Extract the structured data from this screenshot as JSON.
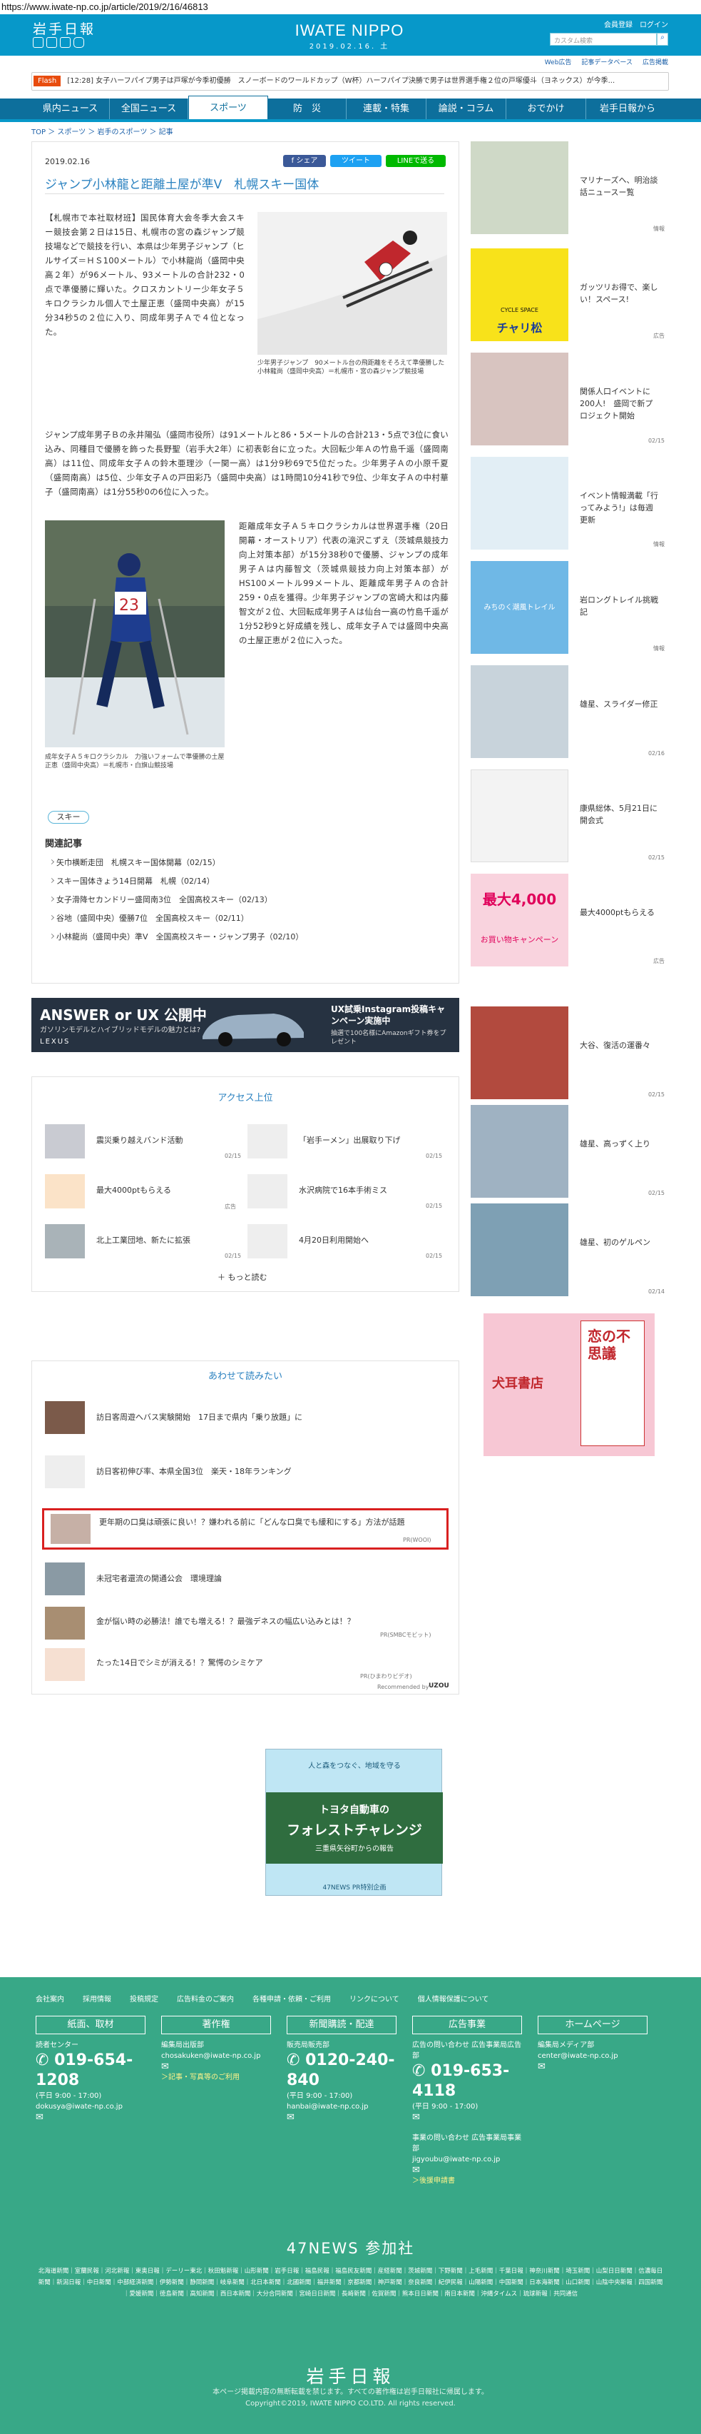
{
  "url": "https://www.iwate-np.co.jp/article/2019/2/16/46813",
  "header": {
    "logo_jp": "岩手日報",
    "logo_en": "IWATE NIPPO",
    "date": "2019.02.16. 土",
    "login": "会員登録　ログイン",
    "search_placeholder": "カスタム検索",
    "sublinks": [
      "Web広告",
      "記事データベース",
      "広告掲載"
    ]
  },
  "flash": {
    "label": "Flash",
    "text": "[12:28] 女子ハーフパイプ男子は戸塚が今季初優勝　スノーボードのワールドカップ（W杯）ハーフパイプ決勝で男子は世界選手権２位の戸塚優斗（ヨネックス）が今季..."
  },
  "nav": [
    "県内ニュース",
    "全国ニュース",
    "スポーツ",
    "防　災",
    "連載・特集",
    "論説・コラム",
    "おでかけ",
    "岩手日報から"
  ],
  "breadcrumb": "TOP ＞ スポーツ ＞ 岩手のスポーツ ＞ 記事",
  "article": {
    "date": "2019.02.16",
    "share": [
      "f シェア",
      "ツイート",
      "LINEで送る"
    ],
    "title": "ジャンプ小林龍と距離土屋が準V　札幌スキー国体",
    "p1": "【札幌市で本社取材班】国民体育大会冬季大会スキー競技会第２日は15日、札幌市の宮の森ジャンプ競技場などで競技を行い、本県は少年男子ジャンプ（ヒルサイズ＝ＨＳ100メートル）で小林龍尚（盛岡中央高２年）が96メートル、93メートルの合計232・0点で準優勝に輝いた。クロスカントリー少年女子５キロクラシカル個人で土屋正恵（盛岡中央高）が15分34秒5の２位に入り、同成年男子Ａで４位となった。",
    "p2": "ジャンプ成年男子Ｂの永井陽弘（盛岡市役所）は91メートルと86・5メートルの合計213・5点で3位に食い込み、同種目で優勝を飾った長野聖（岩手大2年）に初表彰台に立った。大回転少年Ａの竹島千遥（盛岡南高）は11位、同成年女子Ａの鈴木亜理沙（一関一高）は1分9秒69で5位だった。少年男子Ａの小原千夏（盛岡南高）は5位、少年女子Ａの戸田彩乃（盛岡中央高）は1時間10分41秒で9位、少年女子Ａの中村華子（盛岡南高）は1分55秒0の6位に入った。",
    "p3": "距離成年女子Ａ５キロクラシカルは世界選手権（20日開幕・オーストリア）代表の滝沢こずえ（茨城県競技力向上対策本部）が15分38秒0で優勝、ジャンプの成年男子Ａは内藤智文（茨城県競技力向上対策本部）がHS100メートル99メートル、距離成年男子Ａの合計259・0点を獲得。少年男子ジャンプの宮崎大和は内藤智文が２位、大回転成年男子Ａは仙台一高の竹島千遥が1分52秒9と好成績を残し、成年女子Ａでは盛岡中央高の土屋正恵が２位に入った。",
    "photo1_caption": "少年男子ジャンプ　90メートル台の飛距離をそろえて準優勝した小林龍尚（盛岡中央高）＝札幌市・宮の森ジャンプ競技場",
    "photo2_caption": "成年女子Ａ５キロクラシカル　力強いフォームで準優勝の土屋正恵（盛岡中央高）＝札幌市・白旗山競技場",
    "tag": "スキー",
    "related_title": "関連記事",
    "related": [
      "矢巾横断走団　札幌スキー国体開幕（02/15）",
      "スキー国体きょう14日開幕　札幌（02/14）",
      "女子滑降セカンドリー盛岡南3位　全国高校スキー（02/13）",
      "谷地（盛岡中央）優勝7位　全国高校スキー（02/11）",
      "小林龍尚（盛岡中央）準V　全国高校スキー・ジャンプ男子（02/10）"
    ]
  },
  "banner_ad": {
    "left_title": "ANSWER or UX 公開中",
    "left_sub": "ガソリンモデルとハイブリッドモデルの魅力とは?",
    "brand": "LEXUS",
    "right_title": "UX試乗Instagram投稿キャンペーン実施中",
    "right_sub": "抽選で100名様にAmazonギフト券をプレゼント"
  },
  "ranking": {
    "title": "アクセス上位",
    "items": [
      {
        "text": "震災乗り越えバンド活動",
        "date": "02/15"
      },
      {
        "text": "「岩手ーメン」出展取り下げ",
        "date": "02/15"
      },
      {
        "text": "最大4000ptもらえる",
        "date": "広告"
      },
      {
        "text": "水沢病院で16本手術ミス",
        "date": "02/15"
      },
      {
        "text": "北上工業団地、新たに拡張",
        "date": "02/15"
      },
      {
        "text": "4月20日利用開始へ",
        "date": "02/15"
      }
    ],
    "more": "もっと読む"
  },
  "together": {
    "title": "あわせて読みたい",
    "items": [
      {
        "text": "訪日客周遊へバス実験開始　17日まで県内「乗り放題」に",
        "meta": ""
      },
      {
        "text": "訪日客初伸び率、本県全国3位　楽天・18年ランキング",
        "meta": ""
      },
      {
        "text": "更年期の口臭は頑張に良い！？嫌われる前に「どんな口臭でも緩和にする」方法が話題",
        "meta": "PR(WOOI)"
      },
      {
        "text": "未冠宅者還流の開通公会　環境理論",
        "meta": ""
      },
      {
        "text": "金が悩い時の必勝法！誰でも増える！？最強デネスの幅広い込みとは！？",
        "meta": "PR(SMBCモビット)"
      },
      {
        "text": "たった14日でシミが消える！？驚愕のシミケア",
        "meta": "PR(ひまわりビデオ)"
      }
    ],
    "recommended": "Recommended by"
  },
  "bottom_ad": {
    "line1": "人と森をつなぐ、地域を守る",
    "line2": "トヨタ自動車の",
    "line3": "フォレストチャレンジ",
    "line4": "三重県矢谷町からの報告",
    "footer": "47NEWS PR特別企画"
  },
  "sidebar": [
    {
      "text": "マリナーズへ、明治談話ニュースー覧",
      "meta": "情報"
    },
    {
      "text": "ガッツリお得で、楽しい！スペース!",
      "meta": "広告"
    },
    {
      "text": "関係人口イベントに200人!　盛岡で新プロジェクト開始",
      "meta": "02/15"
    },
    {
      "text": "イベント情報満載「行ってみよう!」は毎週更新",
      "meta": "情報"
    },
    {
      "text": "岩ロングトレイル挑戦記",
      "meta": "情報"
    },
    {
      "text": "雄星、スライダー修正",
      "meta": "02/16"
    },
    {
      "text": "康県総体、5月21日に開会式",
      "meta": "02/15"
    },
    {
      "text": "最大4000ptもらえる",
      "meta": "広告"
    },
    {
      "text": "大谷、復活の運番々",
      "meta": "02/15"
    },
    {
      "text": "雄星、高っずく上り",
      "meta": "02/15"
    },
    {
      "text": "雄星、初のゲルペン",
      "meta": "02/14"
    }
  ],
  "side_ad": {
    "text": "恋の不思議",
    "shop": "犬耳書店"
  },
  "side_badges": {
    "chari_top": "CYCLE SPACE",
    "chari": "チャリ松",
    "trail": "みちのく潮風トレイル",
    "point": "最大4,000",
    "point_sub": "お買い物キャンペーン"
  },
  "footer": {
    "links": [
      "会社案内",
      "採用情報",
      "投稿規定",
      "広告料金のご案内",
      "各種申請・依頼・ご利用",
      "リンクについて",
      "個人情報保護について"
    ],
    "columns": [
      {
        "head": "紙面、取材",
        "sub": "読者センター",
        "tel": "019-654-1208",
        "hours": "(平日 9:00 - 17:00)",
        "mail": "dokusya@iwate-np.co.jp"
      },
      {
        "head": "著作権",
        "sub": "編集局出版部",
        "tel": "",
        "hours": "",
        "mail": "chosakuken@iwate-np.co.jp",
        "extra": "＞記事・写真等のご利用"
      },
      {
        "head": "新聞購読・配達",
        "sub": "販売局販売部",
        "tel": "0120-240-840",
        "hours": "(平日 9:00 - 17:00)",
        "mail": "hanbai@iwate-np.co.jp"
      },
      {
        "head": "広告事業",
        "sub": "広告の問い合わせ 広告事業局広告部",
        "tel": "019-653-4118",
        "hours": "(平日 9:00 - 17:00)",
        "mail": "jigyoubu@iwate-np.co.jp",
        "extra": "＞後援申請書"
      },
      {
        "head": "ホームページ",
        "sub": "編集局メディア部",
        "tel": "",
        "hours": "",
        "mail": "center@iwate-np.co.jp"
      }
    ],
    "events_sub": "事業の問い合わせ 広告事業局事業部",
    "title_47": "47NEWS 参加社",
    "partners": "北海道新聞｜室蘭民報｜河北新報｜東奥日報｜デーリー東北｜秋田魁新報｜山形新聞｜岩手日報｜福島民報｜福島民友新聞｜産経新聞｜茨城新聞｜下野新聞｜上毛新聞｜千葉日報｜神奈川新聞｜埼玉新聞｜山梨日日新聞｜信濃毎日新聞｜新潟日報｜中日新聞｜中部経済新聞｜伊勢新聞｜静岡新聞｜岐阜新聞｜北日本新聞｜北國新聞｜福井新聞｜京都新聞｜神戸新聞｜奈良新聞｜紀伊民報｜山陽新聞｜中国新聞｜日本海新聞｜山口新聞｜山陰中央新報｜四国新聞｜愛媛新聞｜徳島新聞｜高知新聞｜西日本新聞｜大分合同新聞｜宮崎日日新聞｜長崎新聞｜佐賀新聞｜熊本日日新聞｜南日本新聞｜沖縄タイムス｜琉球新報｜共同通信",
    "logo": "岩手日報",
    "copy1": "本ページ掲載内容の無断転載を禁じます。すべての著作権は岩手日報社に帰属します。",
    "copy2": "Copyright©2019, IWATE NIPPO CO.LTD. All rights reserved."
  }
}
